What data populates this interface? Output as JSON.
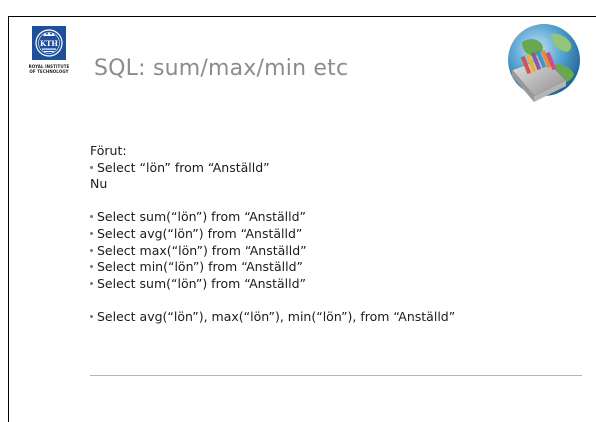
{
  "slide": {
    "title": "SQL: sum/max/min etc",
    "logo": {
      "seal_text": "KTH",
      "caption_lines": [
        "ROYAL INSTITUTE",
        "OF TECHNOLOGY"
      ],
      "color": "#1f4f9b"
    },
    "illustration_icon": "globe-with-file-drawer-icon",
    "body": {
      "before_label": "Förut:",
      "before_items": [
        "Select “lön” from “Anställd”"
      ],
      "now_label": "Nu",
      "aggregate_items": [
        "Select sum(“lön”) from “Anställd”",
        "Select avg(“lön”) from “Anställd”",
        "Select max(“lön”) from “Anställd”",
        "Select min(“lön”) from “Anställd”",
        "Select sum(“lön”) from “Anställd”"
      ],
      "combined_item": "Select avg(“lön”), max(“lön”), min(“lön”), from “Anställd”"
    }
  }
}
